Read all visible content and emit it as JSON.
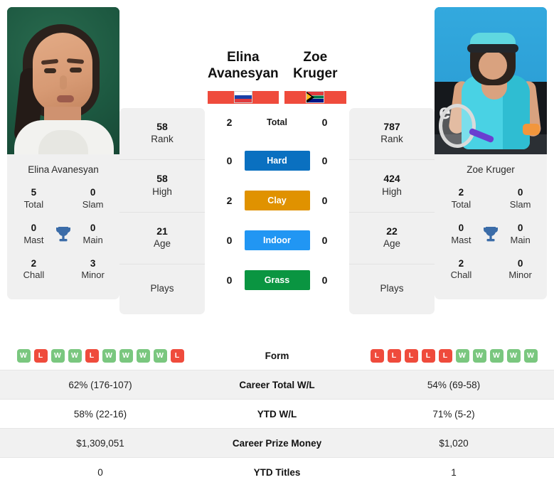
{
  "left_player": {
    "name": "Elina Avanesyan",
    "header_name_line1": "Elina",
    "header_name_line2": "Avanesyan",
    "flag": "russia-flag",
    "card_name": "Elina Avanesyan",
    "titles": [
      {
        "value": "5",
        "label": "Total"
      },
      {
        "value": "0",
        "label": "Slam"
      },
      {
        "value": "0",
        "label": "Mast"
      },
      {
        "value": "0",
        "label": "Main"
      },
      {
        "value": "2",
        "label": "Chall"
      },
      {
        "value": "3",
        "label": "Minor"
      }
    ],
    "ranks": [
      {
        "value": "58",
        "label": "Rank"
      },
      {
        "value": "58",
        "label": "High"
      },
      {
        "value": "21",
        "label": "Age"
      },
      {
        "value": "",
        "label": "Plays"
      }
    ],
    "form": [
      "W",
      "L",
      "W",
      "W",
      "L",
      "W",
      "W",
      "W",
      "W",
      "L"
    ],
    "career_total_wl": "62% (176-107)",
    "ytd_wl": "58% (22-16)",
    "career_prize_money": "$1,309,051",
    "ytd_titles": "0"
  },
  "right_player": {
    "name": "Zoe Kruger",
    "header_name_line1": "Zoe Kruger",
    "header_name_line2": "",
    "flag": "south-africa-flag",
    "card_name": "Zoe Kruger",
    "titles": [
      {
        "value": "2",
        "label": "Total"
      },
      {
        "value": "0",
        "label": "Slam"
      },
      {
        "value": "0",
        "label": "Mast"
      },
      {
        "value": "0",
        "label": "Main"
      },
      {
        "value": "2",
        "label": "Chall"
      },
      {
        "value": "0",
        "label": "Minor"
      }
    ],
    "ranks": [
      {
        "value": "787",
        "label": "Rank"
      },
      {
        "value": "424",
        "label": "High"
      },
      {
        "value": "22",
        "label": "Age"
      },
      {
        "value": "",
        "label": "Plays"
      }
    ],
    "form": [
      "L",
      "L",
      "L",
      "L",
      "L",
      "W",
      "W",
      "W",
      "W",
      "W"
    ],
    "career_total_wl": "54% (69-58)",
    "ytd_wl": "71% (5-2)",
    "career_prize_money": "$1,020",
    "ytd_titles": "1"
  },
  "h2h": [
    {
      "label": "Total",
      "left": "2",
      "right": "0",
      "type": "text",
      "color": ""
    },
    {
      "label": "Hard",
      "left": "0",
      "right": "0",
      "type": "badge",
      "color": "#0a70c0"
    },
    {
      "label": "Clay",
      "left": "2",
      "right": "0",
      "type": "badge",
      "color": "#e09200"
    },
    {
      "label": "Indoor",
      "left": "0",
      "right": "0",
      "type": "badge",
      "color": "#2196f3"
    },
    {
      "label": "Grass",
      "left": "0",
      "right": "0",
      "type": "badge",
      "color": "#0a9541"
    }
  ],
  "table_rows": [
    {
      "label": "Form",
      "type": "form"
    },
    {
      "label": "Career Total W/L",
      "type": "text",
      "left": "62% (176-107)",
      "right": "54% (69-58)"
    },
    {
      "label": "YTD W/L",
      "type": "text",
      "left": "58% (22-16)",
      "right": "71% (5-2)"
    },
    {
      "label": "Career Prize Money",
      "type": "text",
      "left": "$1,309,051",
      "right": "$1,020"
    },
    {
      "label": "YTD Titles",
      "type": "text",
      "left": "0",
      "right": "1"
    }
  ],
  "icons": {
    "trophy": "trophy-icon"
  },
  "colors": {
    "win": "#7ac77f",
    "loss": "#ef4b3c",
    "hard": "#0a70c0",
    "clay": "#e09200",
    "indoor": "#2196f3",
    "grass": "#0a9541",
    "trophy": "#3b6ca8",
    "card_bg": "#f0f0f0"
  }
}
